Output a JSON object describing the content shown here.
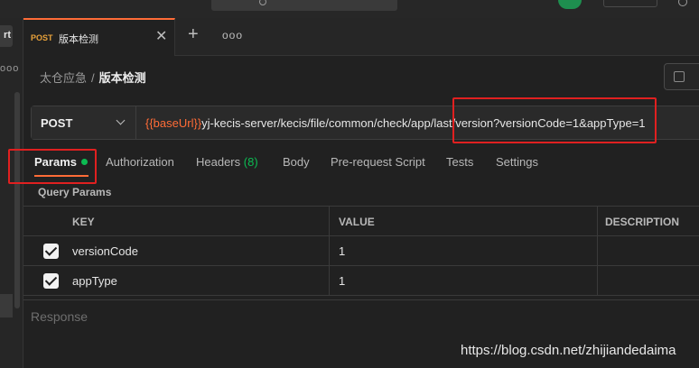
{
  "tab": {
    "method": "POST",
    "name": "版本检测"
  },
  "left_strip": {
    "import_label": "rt",
    "more_label": "ooo"
  },
  "tabs_row": {
    "add_label": "+",
    "more_label": "ooo",
    "close_label": "✕"
  },
  "breadcrumb": {
    "root": "太仓应急",
    "separator": "/",
    "current": "版本检测"
  },
  "request": {
    "method": "POST",
    "url_variable": "{{baseUrl}}",
    "url_rest": "yj-kecis-server/kecis/file/common/check/app/last/version?versionCode=1&appType=1"
  },
  "subtabs": {
    "params": "Params",
    "authorization": "Authorization",
    "headers": "Headers",
    "headers_count": "(8)",
    "body": "Body",
    "prerequest": "Pre-request Script",
    "tests": "Tests",
    "settings": "Settings"
  },
  "query_params": {
    "label": "Query Params",
    "columns": [
      "KEY",
      "VALUE",
      "DESCRIPTION"
    ],
    "rows": [
      {
        "key": "versionCode",
        "value": "1",
        "checked": true
      },
      {
        "key": "appType",
        "value": "1",
        "checked": true
      }
    ]
  },
  "response": {
    "label": "Response"
  },
  "watermark": "https://blog.csdn.net/zhijiandedaima",
  "colors": {
    "accent": "#ff6c37",
    "method_orange": "#e8a13a",
    "status_green": "#0cbb52",
    "annotation_red": "#e02020"
  }
}
